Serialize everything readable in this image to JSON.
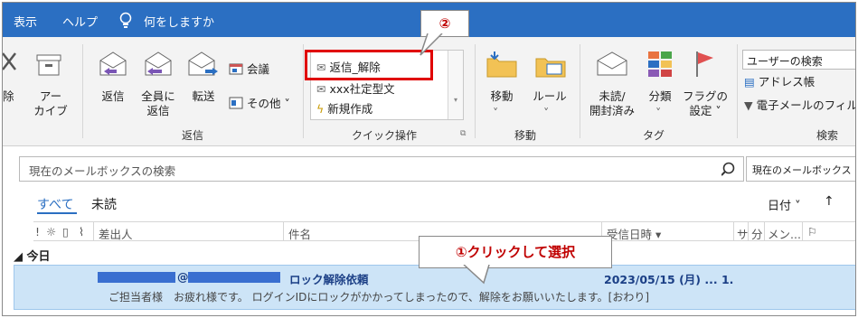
{
  "menubar": {
    "items": [
      "表示",
      "ヘルプ"
    ],
    "tell_me": "何をしますか"
  },
  "ribbon": {
    "delete_fragment": "除",
    "archive_label": [
      "アー",
      "カイブ"
    ],
    "reply": "返信",
    "reply_all": [
      "全員に",
      "返信"
    ],
    "forward": "転送",
    "meeting": "会議",
    "more": "その他",
    "group_respond": "返信",
    "quick_steps": [
      "返信_解除",
      "xxx社定型文",
      "新規作成"
    ],
    "group_quick_steps": "クイック操作",
    "move": "移動",
    "rules": "ルール",
    "group_move": "移動",
    "unread_read": [
      "未読/",
      "開封済み"
    ],
    "categorize": "分類",
    "flag": [
      "フラグの",
      "設定"
    ],
    "group_tags": "タグ",
    "search_people": "ユーザーの検索",
    "address_book": "アドレス帳",
    "filter_email": "電子メールのフィル",
    "group_find": "検索"
  },
  "callouts": {
    "step2": "②",
    "step1": "①クリックして選択"
  },
  "search": {
    "placeholder": "現在のメールボックスの検索",
    "scope": "現在のメールボックス"
  },
  "view": {
    "tab_all": "すべて",
    "tab_unread": "未読",
    "sort": "日付",
    "sort_arrow": "↑"
  },
  "columns": {
    "from": "差出人",
    "subject": "件名",
    "received": "受信日時",
    "size": "サ",
    "category": "分",
    "mention": "メン..."
  },
  "group_today": "今日",
  "mail": {
    "sender_suffix": "@",
    "subject": "ロック解除依頼",
    "received": "2023/05/15 (月) ... 1.",
    "preview": "ご担当者様　お疲れ様です。 ログインIDにロックがかかってしまったので、解除をお願いいたします。[おわり]"
  },
  "colors": {
    "menubar": "#2b6fc2",
    "selection": "#cde4f7",
    "redaction": "#3a6fd0",
    "highlight": "#e00000",
    "callout_text": "#c00000"
  }
}
